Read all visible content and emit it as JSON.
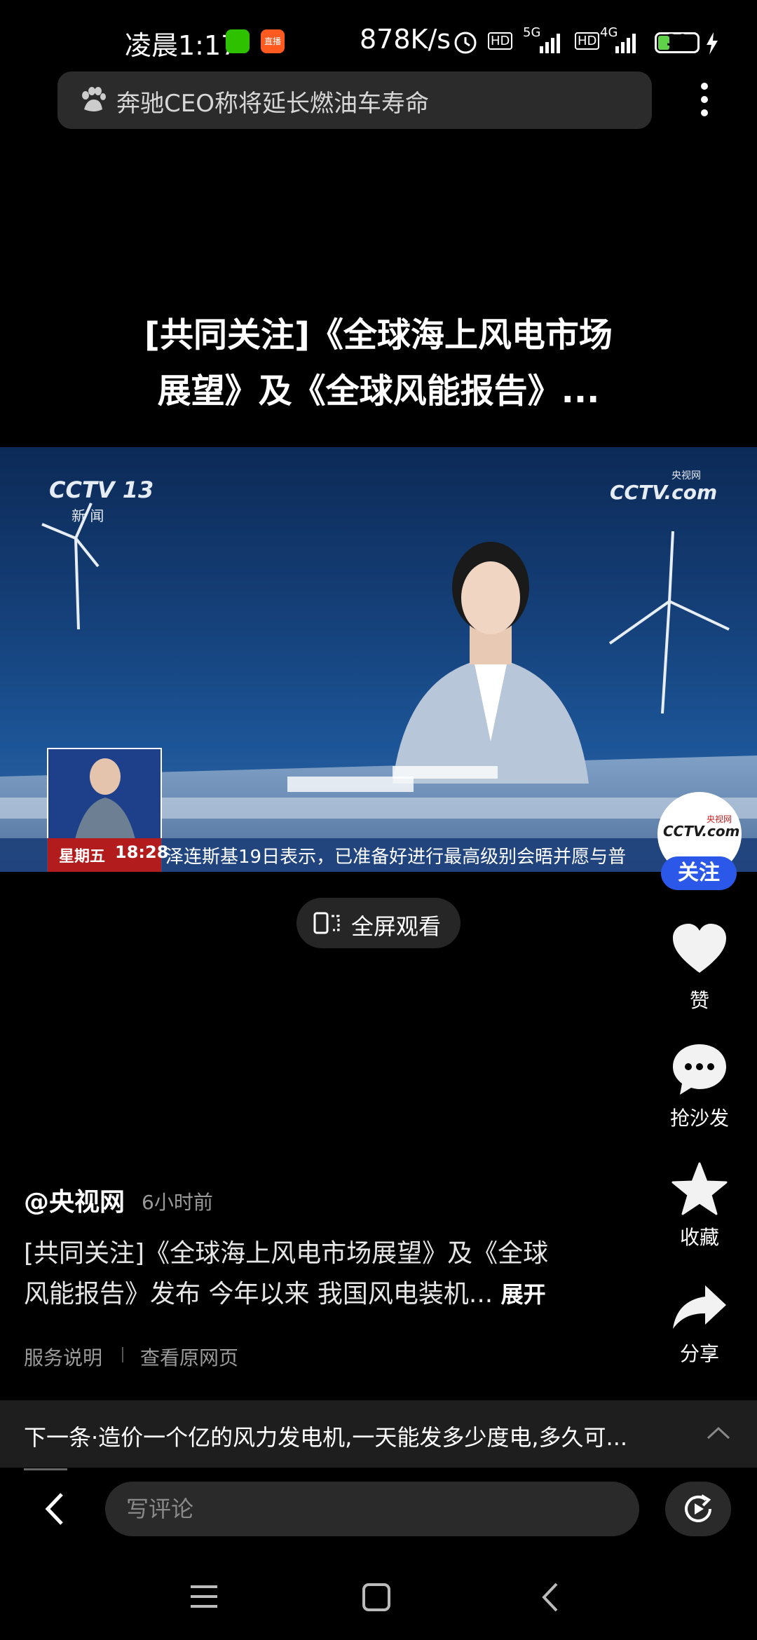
{
  "status_bar": {
    "time": "凌晨1:17",
    "speed": "878K/s",
    "battery": "30",
    "battery_level": 0.3,
    "network1": "5G",
    "network2": "4G",
    "hd": "HD",
    "app_badge": "直播"
  },
  "search": {
    "query": "奔驰CEO称将延长燃油车寿命"
  },
  "video": {
    "title_line1": "[共同关注]《全球海上风电市场",
    "title_line2": "展望》及《全球风能报告》...",
    "channel_logo": "CCTV 13",
    "channel_sub": "新 闻",
    "watermark": "CCTV.com",
    "watermark_sub": "央视网",
    "ticker_day": "星期五",
    "ticker_time": "18:28",
    "ticker_text": "泽连斯基19日表示，已准备好进行最高级别会晤并愿与普"
  },
  "fullscreen_label": "全屏观看",
  "actions": {
    "follow": "关注",
    "avatar_text": "CCTV.com",
    "avatar_sub": "央视网",
    "like": "赞",
    "comment": "抢沙发",
    "favorite": "收藏",
    "share": "分享"
  },
  "post": {
    "author": "@央视网",
    "time_ago": "6小时前",
    "desc_line1": "[共同关注]《全球海上风电市场展望》及《全球",
    "desc_line2": "风能报告》发布 今年以来 我国风电装机...",
    "expand": "展开",
    "service_note": "服务说明",
    "view_original": "查看原网页"
  },
  "next": {
    "text": "下一条·造价一个亿的风力发电机,一天能发多少度电,多久可..."
  },
  "comment": {
    "placeholder": "写评论"
  },
  "colors": {
    "follow_blue": "#2b58e8",
    "background": "#000000",
    "battery_green": "#5fd24a"
  }
}
